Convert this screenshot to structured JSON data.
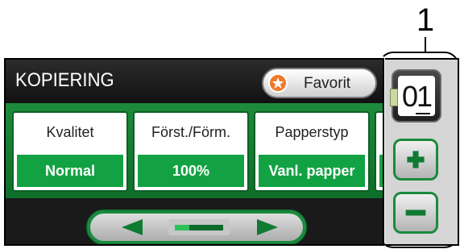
{
  "callout": {
    "number": "1"
  },
  "header": {
    "title": "KOPIERING",
    "favorite_label": "Favorit"
  },
  "cards": [
    {
      "label": "Kvalitet",
      "value": "Normal"
    },
    {
      "label": "Först./Förm.",
      "value": "100%"
    },
    {
      "label": "Papperstyp",
      "value": "Vanl. papper"
    }
  ],
  "copies": {
    "value": "01"
  },
  "navigation": {
    "scroll_position": 0.25
  },
  "colors": {
    "accent_green": "#13a243",
    "band_green": "#1e8b3c",
    "favorite_star": "#ee7a2a",
    "screen_dark": "#1a1a1a"
  },
  "icons": [
    "star-icon",
    "arrow-left-icon",
    "arrow-right-icon",
    "plus-icon",
    "minus-icon"
  ]
}
